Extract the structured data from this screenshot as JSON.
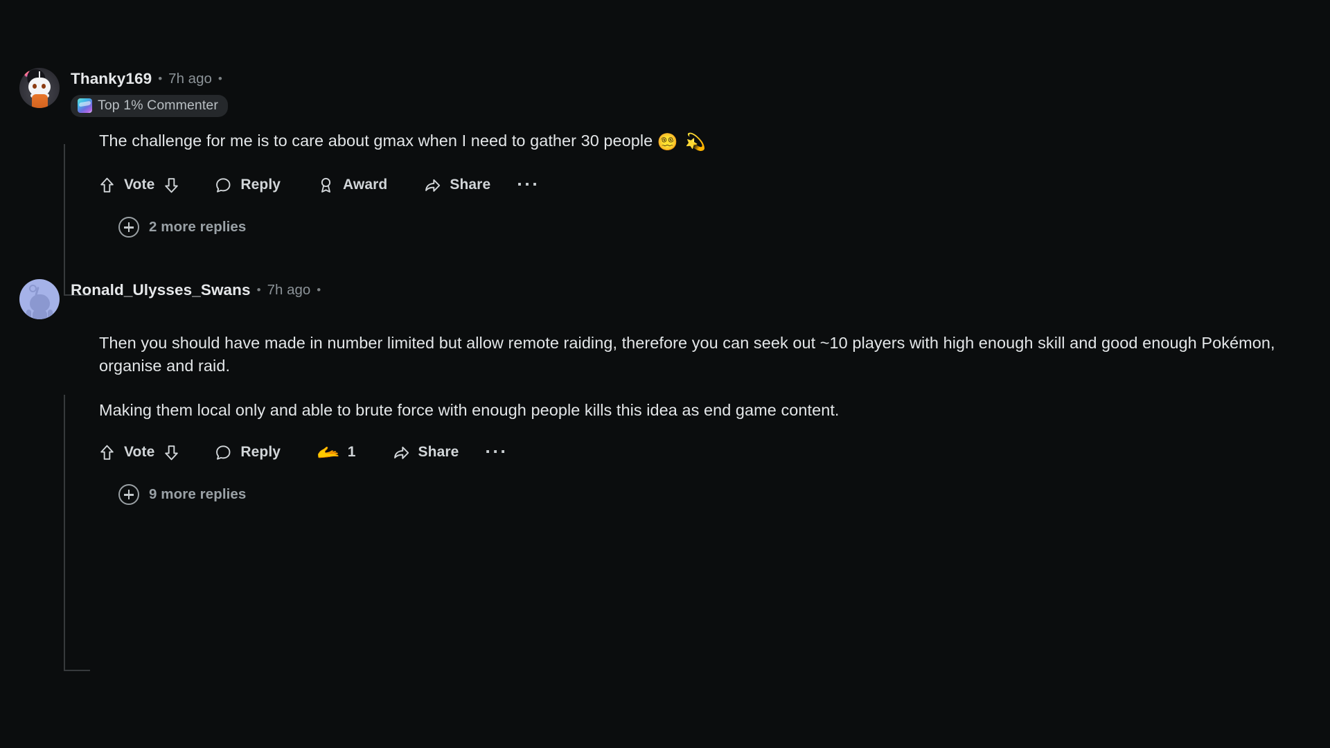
{
  "theme": {
    "background": "#0b0d0e",
    "text_primary": "#e3e6e8",
    "text_muted": "#8b9297",
    "thread_line": "#373a3c",
    "badge_background": "#25282b",
    "award_gold": "#f2a93b",
    "avatar_default": "#a5b2e8"
  },
  "comments": [
    {
      "id": "thanky",
      "username": "Thanky169",
      "separator": "•",
      "timestamp": "7h ago",
      "separator2": "•",
      "badge": {
        "icon": "top-commenter-icon",
        "label": "Top 1% Commenter"
      },
      "paragraphs": [
        "The challenge for me is to care about gmax when I need to gather 30 people "
      ],
      "emoji": "😵‍💫 💫",
      "actions": {
        "upvote_icon": "upvote-arrow-icon",
        "vote_label": "Vote",
        "downvote_icon": "downvote-arrow-icon",
        "reply_icon": "comment-bubble-icon",
        "reply_label": "Reply",
        "award_icon": "award-ribbon-icon",
        "award_label": "Award",
        "share_icon": "share-arrow-icon",
        "share_label": "Share",
        "overflow_label": "···"
      },
      "more_replies": "2 more replies"
    },
    {
      "id": "ronald",
      "username": "Ronald_Ulysses_Swans",
      "separator": "•",
      "timestamp": "7h ago",
      "separator2": "•",
      "paragraphs": [
        "Then you should have made in number limited but allow remote raiding, therefore you can seek out ~10 players with high enough skill and good enough Pokémon, organise and raid.",
        "Making them local only and able to brute force with enough people kills this idea as end game content."
      ],
      "actions": {
        "upvote_icon": "upvote-arrow-icon",
        "vote_label": "Vote",
        "downvote_icon": "downvote-arrow-icon",
        "reply_icon": "comment-bubble-icon",
        "reply_label": "Reply",
        "award_emoji": "🫴",
        "award_count": "1",
        "share_icon": "share-arrow-icon",
        "share_label": "Share",
        "overflow_label": "···"
      },
      "more_replies": "9 more replies"
    }
  ]
}
